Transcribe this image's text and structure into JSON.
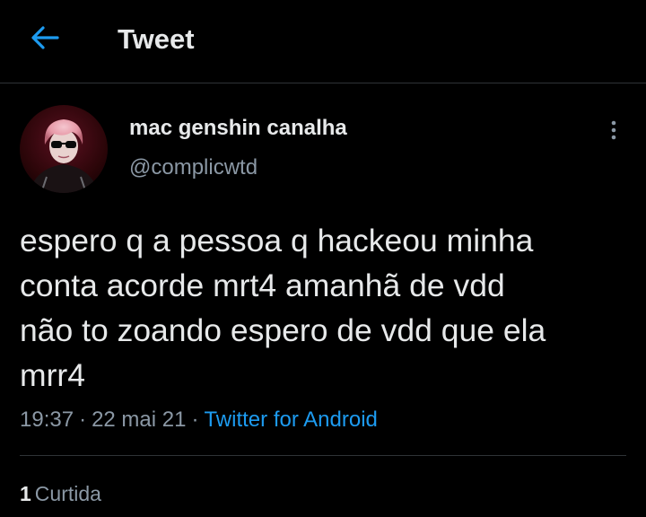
{
  "header": {
    "title": "Tweet",
    "back_icon": "back-arrow-icon",
    "accent_color": "#1d9bf0"
  },
  "author": {
    "display_name": "mac genshin canalha",
    "handle": "@complicwtd"
  },
  "tweet": {
    "text": "espero q a pessoa q hackeou minha\nconta acorde mrt4 amanhã de vdd\nnão to zoando espero de vdd que ela\nmrr4",
    "time": "19:37",
    "date": "22 mai 21",
    "separator": "·",
    "source": "Twitter for Android"
  },
  "stats": {
    "likes_count": "1",
    "likes_label": "Curtida"
  },
  "colors": {
    "background": "#000000",
    "primary_text": "#e7e9ea",
    "secondary_text": "#8b98a5",
    "link": "#1d9bf0",
    "divider": "#2f3336"
  }
}
